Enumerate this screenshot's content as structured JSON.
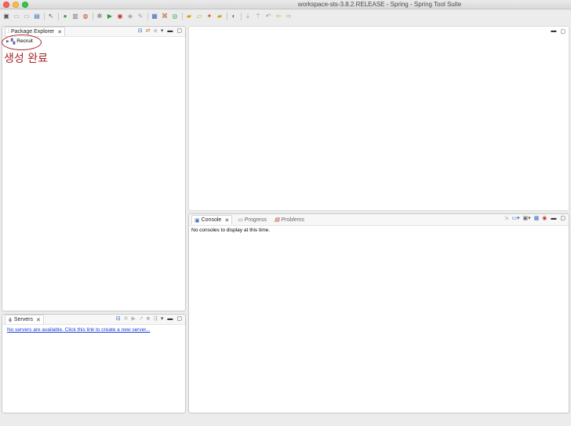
{
  "window": {
    "title": "workspace-sts-3.8.2.RELEASE - Spring - Spring Tool Suite"
  },
  "toolbar": {
    "icons": [
      "new-icon",
      "save-icon",
      "save-all-icon",
      "terminal-icon",
      "cursor-icon",
      "spring-icon",
      "layout-icon",
      "boot-dashboard-icon",
      "debug-icon",
      "run-icon",
      "external-tools-icon",
      "coverage-icon",
      "open-task-icon",
      "package-icon",
      "open-type-icon",
      "web-browser-icon",
      "folder-icon",
      "open-folder-icon",
      "wand-icon",
      "task-folder-icon",
      "globe-icon",
      "nav-prev-icon",
      "nav-next-icon",
      "back-icon",
      "forward-icon"
    ]
  },
  "package_explorer": {
    "tab_label": "Package Explorer",
    "project": "Recruit",
    "annotation": "생성 완료"
  },
  "servers": {
    "tab_label": "Servers",
    "message": "No servers are available. Click this link to create a new server..."
  },
  "console": {
    "tabs": [
      "Console",
      "Progress",
      "Problems"
    ],
    "message": "No consoles to display at this time."
  },
  "colors": {
    "annotation": "#a8262c",
    "link": "#1a3fd8",
    "accent": "#3d6fbf"
  }
}
